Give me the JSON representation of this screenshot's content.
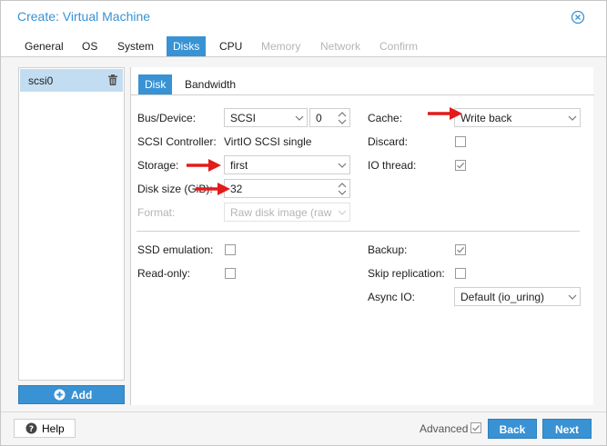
{
  "window": {
    "title": "Create: Virtual Machine",
    "close_icon": "close-circle-icon"
  },
  "tabs": [
    {
      "label": "General",
      "state": "normal"
    },
    {
      "label": "OS",
      "state": "normal"
    },
    {
      "label": "System",
      "state": "normal"
    },
    {
      "label": "Disks",
      "state": "active"
    },
    {
      "label": "CPU",
      "state": "normal"
    },
    {
      "label": "Memory",
      "state": "disabled"
    },
    {
      "label": "Network",
      "state": "disabled"
    },
    {
      "label": "Confirm",
      "state": "disabled"
    }
  ],
  "devices": {
    "items": [
      {
        "label": "scsi0",
        "selected": true
      }
    ],
    "delete_icon": "trash-icon",
    "add_label": "Add"
  },
  "subtabs": [
    {
      "label": "Disk",
      "active": true
    },
    {
      "label": "Bandwidth",
      "active": false
    }
  ],
  "form": {
    "bus_device_label": "Bus/Device:",
    "bus_value": "SCSI",
    "device_index": "0",
    "scsi_controller_label": "SCSI Controller:",
    "scsi_controller_value": "VirtIO SCSI single",
    "storage_label": "Storage:",
    "storage_value": "first",
    "disk_size_label": "Disk size (GiB):",
    "disk_size_value": "32",
    "format_label": "Format:",
    "format_value": "Raw disk image (raw",
    "cache_label": "Cache:",
    "cache_value": "Write back",
    "discard_label": "Discard:",
    "discard_checked": false,
    "io_thread_label": "IO thread:",
    "io_thread_checked": true,
    "ssd_emulation_label": "SSD emulation:",
    "ssd_emulation_checked": false,
    "read_only_label": "Read-only:",
    "read_only_checked": false,
    "backup_label": "Backup:",
    "backup_checked": true,
    "skip_replication_label": "Skip replication:",
    "skip_replication_checked": false,
    "async_io_label": "Async IO:",
    "async_io_value": "Default (io_uring)"
  },
  "footer": {
    "help_label": "Help",
    "advanced_label": "Advanced",
    "advanced_checked": true,
    "back_label": "Back",
    "next_label": "Next"
  },
  "colors": {
    "accent": "#3892d4",
    "selected_row": "#c2ddf2",
    "annotation_arrow": "#e31b1b"
  }
}
